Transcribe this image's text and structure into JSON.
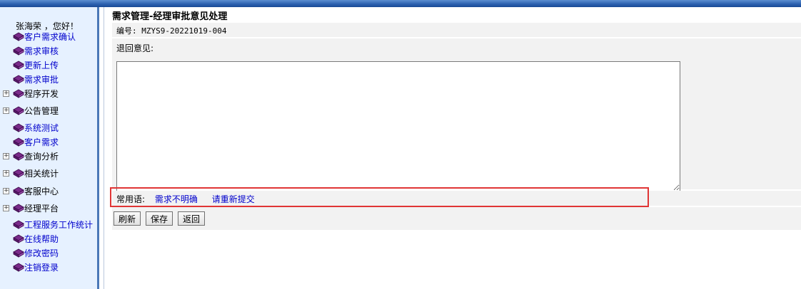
{
  "greeting": "张海荣 ，您好！",
  "sidebar": {
    "items": [
      {
        "label": "客户需求确认",
        "type": "link"
      },
      {
        "label": "需求审核",
        "type": "link"
      },
      {
        "label": "更新上传",
        "type": "link"
      },
      {
        "label": "需求审批",
        "type": "link"
      },
      {
        "label": "程序开发",
        "type": "group"
      },
      {
        "label": "公告管理",
        "type": "group"
      },
      {
        "label": "系统测试",
        "type": "link"
      },
      {
        "label": "客户需求",
        "type": "link"
      },
      {
        "label": "查询分析",
        "type": "group"
      },
      {
        "label": "相关统计",
        "type": "group"
      },
      {
        "label": "客服中心",
        "type": "group"
      },
      {
        "label": "经理平台",
        "type": "group"
      },
      {
        "label": "工程服务工作统计",
        "type": "link"
      },
      {
        "label": "在线帮助",
        "type": "link"
      },
      {
        "label": "修改密码",
        "type": "link"
      },
      {
        "label": "注销登录",
        "type": "link"
      }
    ]
  },
  "main": {
    "title": "需求管理-经理审批意见处理",
    "code_line": "编号: MZYS9-20221019-004",
    "reason_label": "退回意见:",
    "reason_value": "",
    "phrases_label": "常用语:",
    "phrases": [
      "需求不明确",
      "请重新提交"
    ],
    "buttons": {
      "refresh": "刷新",
      "save": "保存",
      "back": "返回"
    }
  },
  "colors": {
    "link": "#0000cc",
    "sidebar_bg": "#e6f1ff",
    "highlight": "#e03535"
  }
}
